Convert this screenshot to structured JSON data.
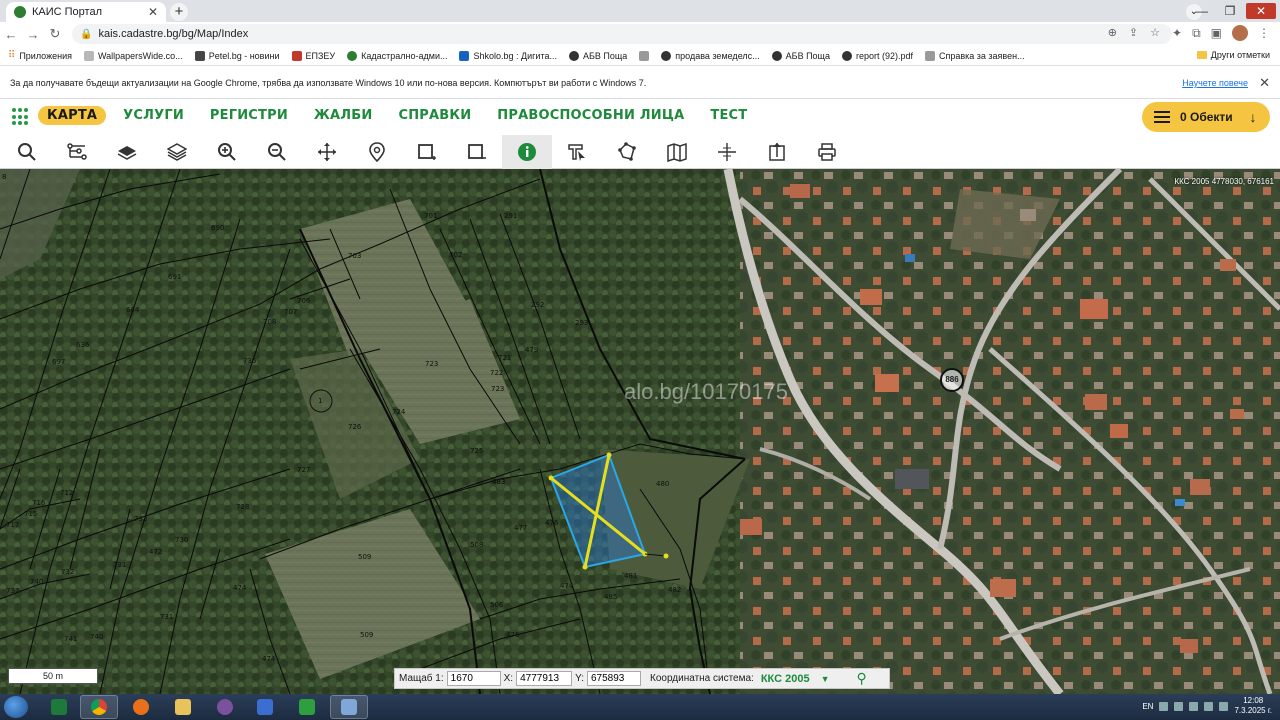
{
  "browser": {
    "tab_title": "КАИС Портал",
    "url": "kais.cadastre.bg/bg/Map/Index"
  },
  "bookmarks": [
    {
      "label": "Приложения",
      "icon": "apps-icon"
    },
    {
      "label": "WallpapersWide.co...",
      "icon": "wallpapers-icon"
    },
    {
      "label": "Petel.bg - новини",
      "icon": "petel-icon"
    },
    {
      "label": "ЕПЗЕУ",
      "icon": "epzeu-icon"
    },
    {
      "label": "Кадастрално-адми...",
      "icon": "cadastre-icon"
    },
    {
      "label": "Shkolo.bg : Дигита...",
      "icon": "shkolo-icon"
    },
    {
      "label": "АБВ Поща",
      "icon": "abv-icon"
    },
    {
      "label": "продава земеделс...",
      "icon": "globe-icon"
    },
    {
      "label": "АБВ Поща",
      "icon": "abv-icon"
    },
    {
      "label": "report (92).pdf",
      "icon": "globe-icon"
    },
    {
      "label": "Справка за заявен...",
      "icon": "page-icon"
    }
  ],
  "other_bookmarks": "Други отметки",
  "infobar": {
    "message": "За да получавате бъдещи актуализации на Google Chrome, трябва да използвате Windows 10 или по-нова версия. Компютърът ви работи с Windows 7.",
    "link": "Научете повече"
  },
  "nav": {
    "items": [
      "КАРТА",
      "УСЛУГИ",
      "РЕГИСТРИ",
      "ЖАЛБИ",
      "СПРАВКИ",
      "ПРАВОСПОСОБНИ ЛИЦА",
      "ТЕСТ"
    ],
    "active_index": 0,
    "objects_label": "0 Обекти"
  },
  "map": {
    "watermark": "alo.bg/10170175",
    "crs_readout": "ККС 2005 4778030, 676161",
    "road_number": "886",
    "scale_label": "50 m",
    "parcels": [
      {
        "label": "8"
      },
      {
        "label": "701"
      },
      {
        "label": "291"
      },
      {
        "label": "690"
      },
      {
        "label": "702"
      },
      {
        "label": "703"
      },
      {
        "label": "691"
      },
      {
        "label": "684"
      },
      {
        "label": "706"
      },
      {
        "label": "707"
      },
      {
        "label": "708"
      },
      {
        "label": "292"
      },
      {
        "label": "293"
      },
      {
        "label": "636"
      },
      {
        "label": "697"
      },
      {
        "label": "735"
      },
      {
        "label": "723"
      },
      {
        "label": "721"
      },
      {
        "label": "722"
      },
      {
        "label": "479"
      },
      {
        "label": "724"
      },
      {
        "label": "726"
      },
      {
        "label": "723"
      },
      {
        "label": "725"
      },
      {
        "label": "727"
      },
      {
        "label": "728"
      },
      {
        "label": "712"
      },
      {
        "label": "716"
      },
      {
        "label": "715"
      },
      {
        "label": "717"
      },
      {
        "label": "730"
      },
      {
        "label": "472"
      },
      {
        "label": "731"
      },
      {
        "label": "732"
      },
      {
        "label": "740"
      },
      {
        "label": "474"
      },
      {
        "label": "509"
      },
      {
        "label": "508"
      },
      {
        "label": "477"
      },
      {
        "label": "476"
      },
      {
        "label": "480"
      },
      {
        "label": "483"
      },
      {
        "label": "481"
      },
      {
        "label": "482"
      },
      {
        "label": "506"
      },
      {
        "label": "476"
      },
      {
        "label": "509"
      },
      {
        "label": "741"
      },
      {
        "label": "740"
      },
      {
        "label": "474"
      },
      {
        "label": "733"
      },
      {
        "label": "731"
      },
      {
        "label": "737"
      },
      {
        "label": "1"
      },
      {
        "label": "474"
      },
      {
        "label": "485"
      },
      {
        "label": "483"
      }
    ]
  },
  "statusbar": {
    "scale_label": "Мащаб 1:",
    "scale_value": "1670",
    "x_label": "X:",
    "x_value": "4777913",
    "y_label": "Y:",
    "y_value": "675893",
    "crs_label": "Координатна система:",
    "crs_value": "ККС 2005"
  },
  "taskbar": {
    "lang": "EN",
    "time": "12:08",
    "date": "7.3.2025 г."
  },
  "colors": {
    "brand_green": "#1e8a3c",
    "accent_yellow": "#f5c542",
    "selection_blue": "#2aa7e6",
    "selection_lines": "#e6e01c"
  }
}
